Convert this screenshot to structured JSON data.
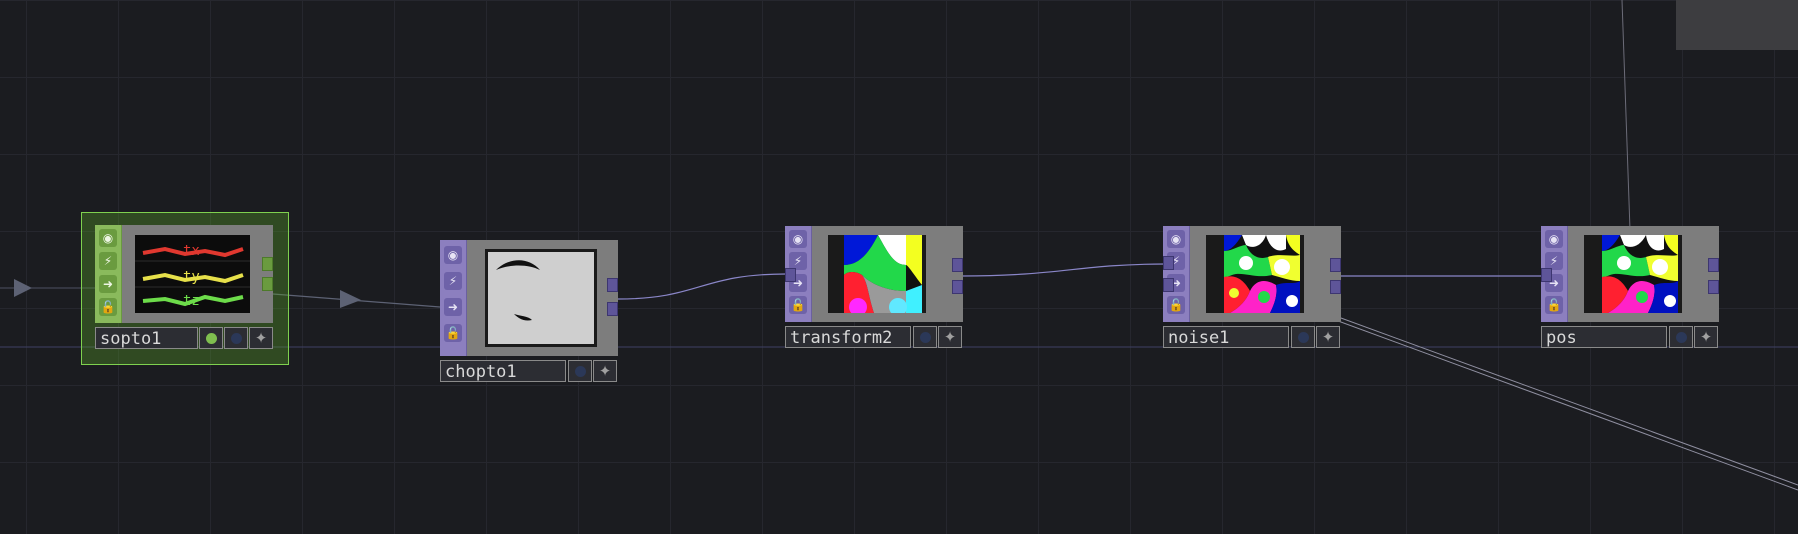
{
  "network": {
    "operators": [
      {
        "id": "sopto1",
        "name": "sopto1",
        "family": "CHOP",
        "selected": true,
        "viewer_trace_labels": [
          "tx",
          "ty",
          "tz"
        ],
        "trace_colors": [
          "#e0382f",
          "#e6e04a",
          "#6ddc4a"
        ]
      },
      {
        "id": "chopto1",
        "name": "chopto1",
        "family": "TOP"
      },
      {
        "id": "transform2",
        "name": "transform2",
        "family": "TOP"
      },
      {
        "id": "noise1",
        "name": "noise1",
        "family": "TOP"
      },
      {
        "id": "pos",
        "name": "pos",
        "family": "TOP"
      }
    ],
    "flag_icons": [
      "viewer-icon",
      "cook-icon",
      "export-icon",
      "lock-icon"
    ],
    "colors": {
      "background": "#1b1c20",
      "top_family": "#8c7fbf",
      "chop_family": "#8aba5c",
      "wire": "#8a86c8"
    }
  }
}
